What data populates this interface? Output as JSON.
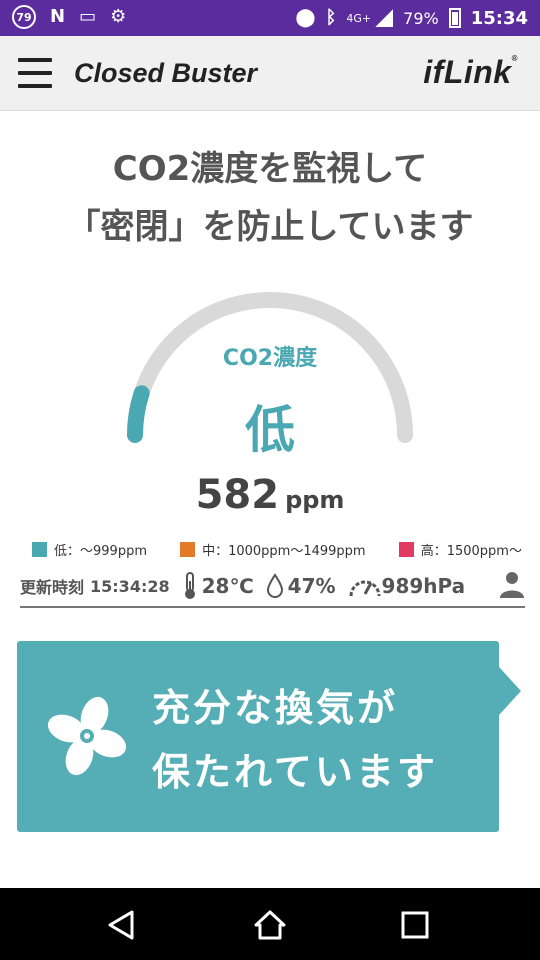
{
  "statusbar": {
    "badge": "79",
    "network": "4G+",
    "battery": "79%",
    "time": "15:34"
  },
  "header": {
    "title": "Closed Buster",
    "logo": "ifLink",
    "logo_mark": "®"
  },
  "headline": {
    "line1": "CO2濃度を監視して",
    "line2": "「密閉」を防止しています"
  },
  "gauge": {
    "label": "CO2濃度",
    "level": "低",
    "value": "582",
    "unit": "ppm",
    "fill_fraction": 0.1
  },
  "legend": [
    {
      "color": "#4aa8b3",
      "label": "低：～999ppm"
    },
    {
      "color": "#e27a2a",
      "label": "中：1000ppm～1499ppm"
    },
    {
      "color": "#e23a63",
      "label": "高：1500ppm～"
    }
  ],
  "info": {
    "update_label": "更新時刻",
    "update_time": "15:34:28",
    "temperature": "28℃",
    "humidity": "47%",
    "pressure": "989hPa"
  },
  "card": {
    "line1": "充分な換気が",
    "line2": "保たれています"
  },
  "colors": {
    "status_bar": "#5b2c9e",
    "accent": "#55adb5",
    "gauge_track": "#d9d9d9"
  }
}
